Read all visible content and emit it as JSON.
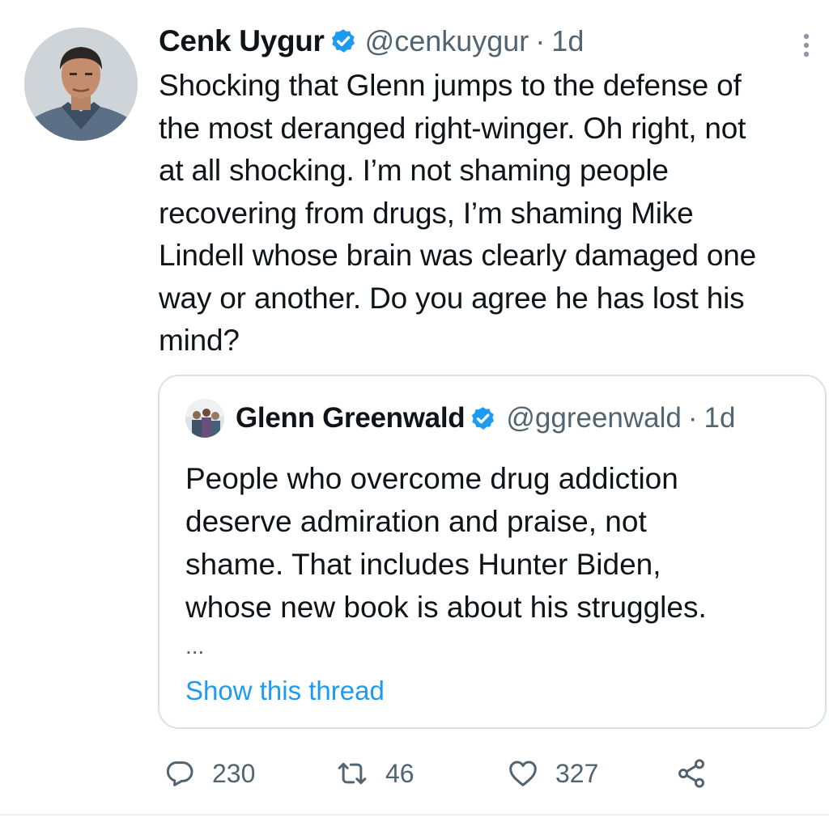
{
  "tweet": {
    "author": {
      "name": "Cenk Uygur",
      "handle": "@cenkuygur",
      "verified": true,
      "avatar_icon": "profile-photo"
    },
    "separator": "·",
    "time": "1d",
    "more_icon": "more-vertical-icon",
    "text": "Shocking that Glenn jumps to the defense of\nthe most deranged right-winger. Oh right, not\nat all shocking. I’m not shaming people\nrecovering from drugs, I’m shaming Mike\nLindell whose brain was clearly damaged one\nway or another. Do you agree he has lost his\nmind?",
    "quoted": {
      "author": {
        "name": "Glenn Greenwald",
        "handle": "@ggreenwald",
        "verified": true,
        "avatar_icon": "profile-photo"
      },
      "separator": "·",
      "time": "1d",
      "text": "People who overcome drug addiction\ndeserve admiration and praise, not\nshame. That includes Hunter Biden,\nwhose new book is about his struggles.",
      "ellipsis": "...",
      "show_thread": "Show this thread"
    },
    "actions": {
      "reply": {
        "icon": "reply-icon",
        "count": "230"
      },
      "retweet": {
        "icon": "retweet-icon",
        "count": "46"
      },
      "like": {
        "icon": "heart-icon",
        "count": "327"
      },
      "share": {
        "icon": "share-icon"
      }
    },
    "colors": {
      "text": "#0f1419",
      "secondary": "#536471",
      "accent": "#1d9bf0",
      "border": "#dbe1e6"
    }
  }
}
